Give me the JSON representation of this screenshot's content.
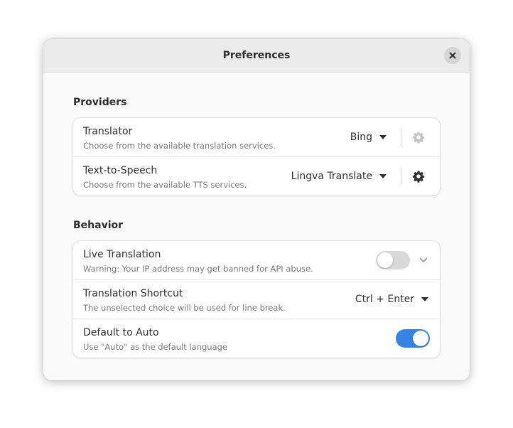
{
  "window": {
    "title": "Preferences",
    "close_icon": "close-icon"
  },
  "providers": {
    "heading": "Providers",
    "rows": [
      {
        "title": "Translator",
        "subtitle": "Choose from the available translation services.",
        "selected": "Bing",
        "settings_icon": "gear-icon",
        "settings_enabled": false
      },
      {
        "title": "Text-to-Speech",
        "subtitle": "Choose from the available TTS services.",
        "selected": "Lingva Translate",
        "settings_icon": "gear-icon",
        "settings_enabled": true
      }
    ]
  },
  "behavior": {
    "heading": "Behavior",
    "rows": [
      {
        "title": "Live Translation",
        "subtitle": "Warning: Your IP address may get banned for API abuse.",
        "toggle_on": false,
        "expander_icon": "chevron-down-icon"
      },
      {
        "title": "Translation Shortcut",
        "subtitle": "The unselected choice will be used for line break.",
        "selected": "Ctrl + Enter"
      },
      {
        "title": "Default to Auto",
        "subtitle": "Use \"Auto\" as the default language",
        "toggle_on": true
      }
    ]
  },
  "colors": {
    "accent": "#3584e4",
    "switch_off": "#d9d9d9",
    "window_bg": "#fafafa",
    "card_bg": "#ffffff",
    "headerbar_bg": "#ebebeb"
  }
}
